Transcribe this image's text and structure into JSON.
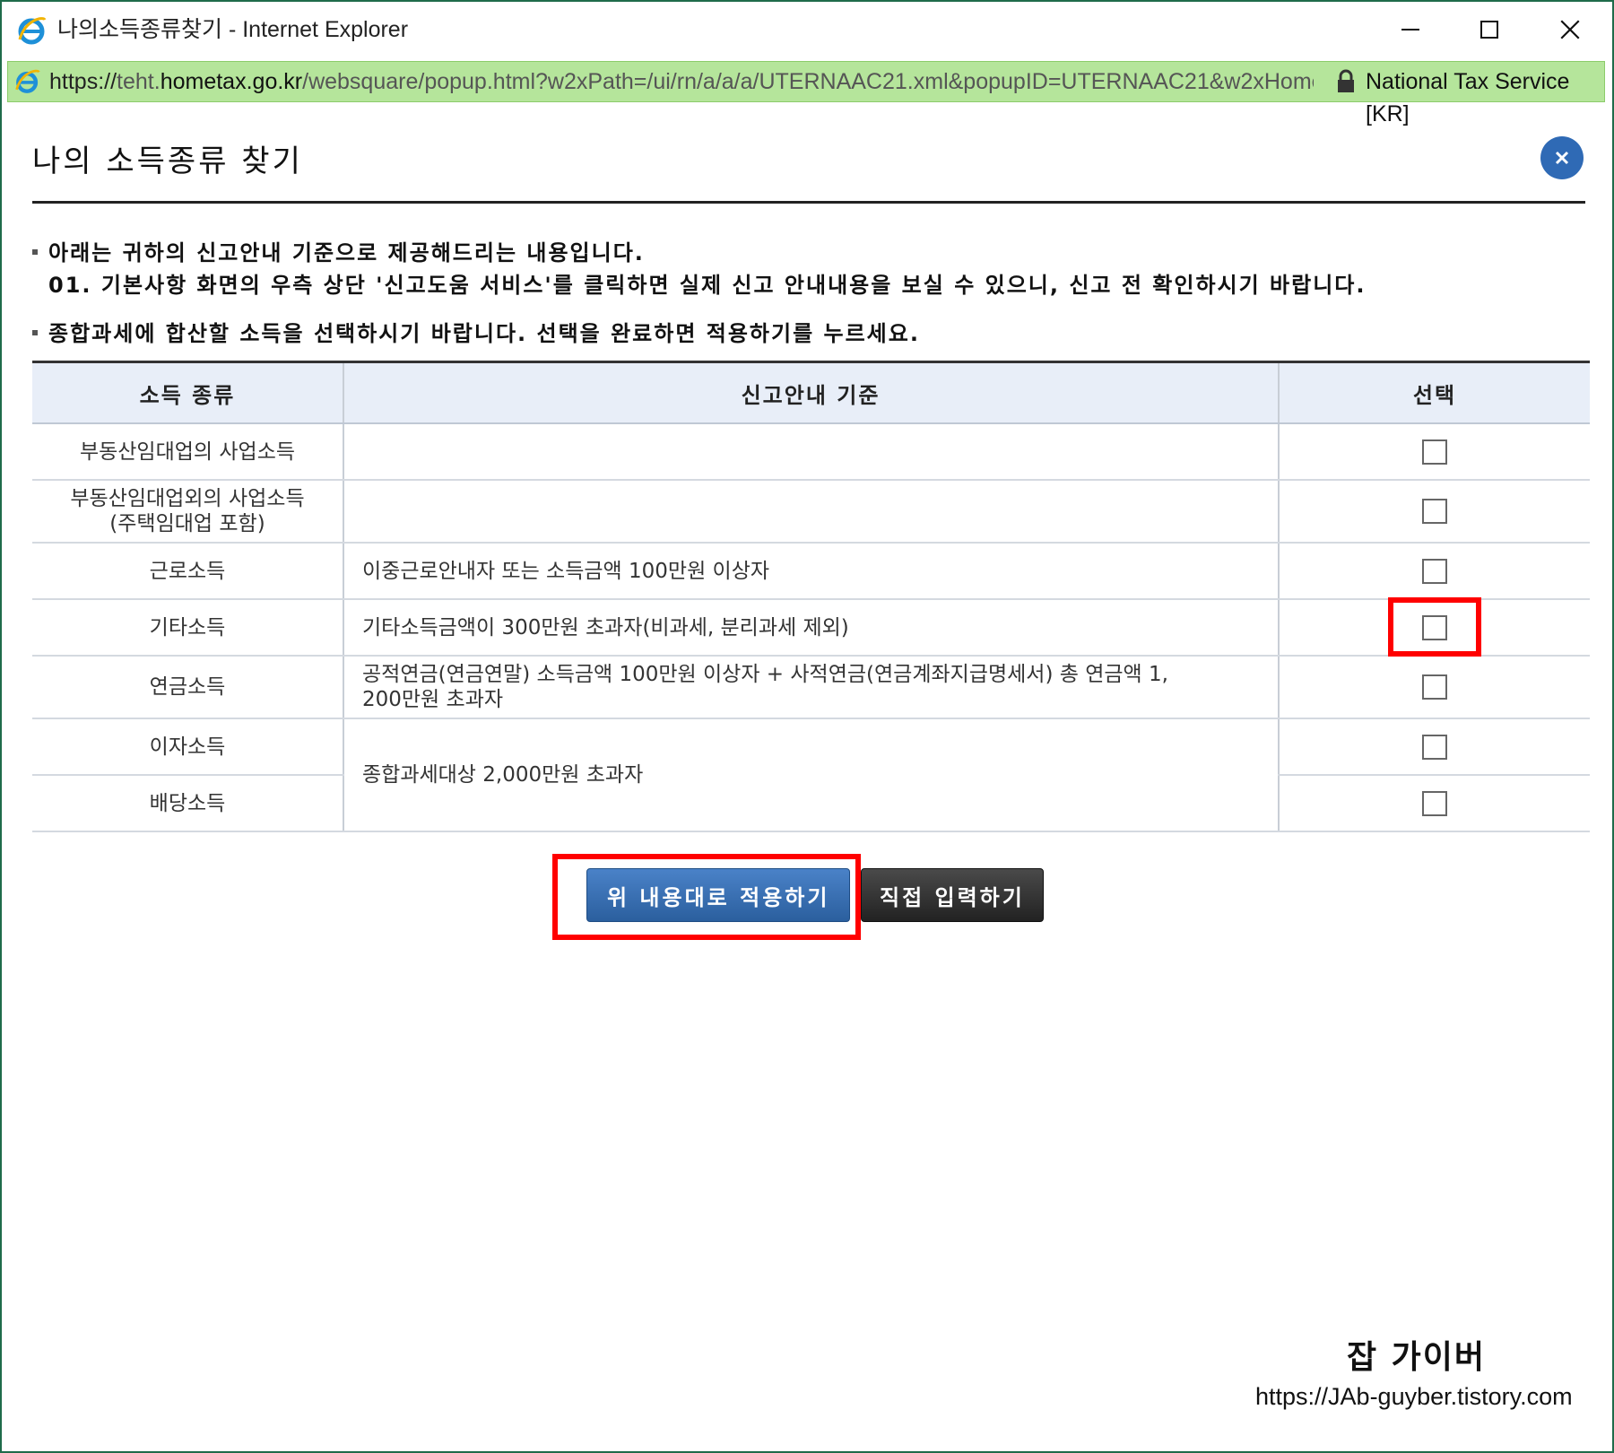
{
  "window": {
    "title": "나의소득종류찾기 - Internet Explorer",
    "controls": {
      "minimize": "—",
      "maximize": "☐",
      "close": "✕"
    }
  },
  "address": {
    "scheme": "https://",
    "host_prefix": "teht.",
    "host": "hometax.go.kr",
    "path": "/websquare/popup.html?w2xPath=/ui/rn/a/a/a/UTERNAAC21.xml&popupID=UTERNAAC21&w2xHome",
    "site_identity": "National Tax Service [KR]"
  },
  "dialog": {
    "title": "나의 소득종류 찾기",
    "close_symbol": "×",
    "notice1_line1": "아래는 귀하의 신고안내 기준으로 제공해드리는 내용입니다.",
    "notice1_line2": "01. 기본사항 화면의 우측 상단 '신고도움 서비스'를 클릭하면 실제 신고 안내내용을 보실 수 있으니, 신고 전 확인하시기 바랍니다.",
    "notice2": "종합과세에 합산할 소득을 선택하시기 바랍니다. 선택을 완료하면 적용하기를 누르세요."
  },
  "table": {
    "headers": {
      "type": "소득 종류",
      "standard": "신고안내 기준",
      "select": "선택"
    },
    "rows": [
      {
        "type": "부동산임대업의 사업소득",
        "standard": "",
        "checked": false
      },
      {
        "type_line1": "부동산임대업외의 사업소득",
        "type_line2": "(주택임대업 포함)",
        "standard": "",
        "checked": false
      },
      {
        "type": "근로소득",
        "standard": "이중근로안내자 또는 소득금액 100만원 이상자",
        "checked": false
      },
      {
        "type": "기타소득",
        "standard": "기타소득금액이 300만원 초과자(비과세, 분리과세 제외)",
        "checked": false
      },
      {
        "type": "연금소득",
        "standard_line1": "공적연금(연금연말) 소득금액 100만원 이상자  + 사적연금(연금계좌지급명세서) 총 연금액 1,",
        "standard_line2": "200만원 초과자",
        "checked": false
      },
      {
        "type": "이자소득",
        "checked": false
      },
      {
        "type": "배당소득",
        "checked": false
      }
    ],
    "merged_standard": "종합과세대상 2,000만원 초과자"
  },
  "buttons": {
    "apply": "위 내용대로 적용하기",
    "direct": "직접 입력하기"
  },
  "watermark": {
    "name": "잡 가이버",
    "url": "https://JAb-guyber.tistory.com"
  },
  "colors": {
    "border": "#1f6b4a",
    "address_bar": "#b5e59b",
    "header_bg": "#e8eef8",
    "apply_button": "#2b5f9e",
    "direct_button": "#2a2a2a",
    "highlight": "#ff0000",
    "close_circle": "#2f6ab5"
  }
}
